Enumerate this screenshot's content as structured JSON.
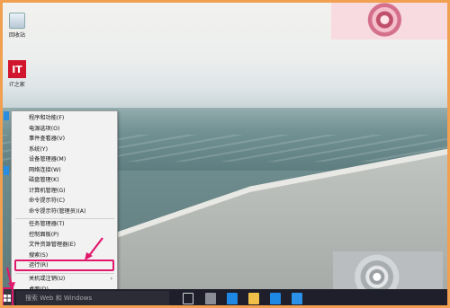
{
  "desktop": {
    "icons": [
      {
        "name": "recycle-bin",
        "label": "回收站"
      },
      {
        "name": "it-shortcut",
        "label": "IT",
        "caption": "IT之家"
      }
    ]
  },
  "context_menu": {
    "group1": [
      "程序和功能(F)",
      "电源选项(O)",
      "事件查看器(V)",
      "系统(Y)",
      "设备管理器(M)",
      "网络连接(W)",
      "磁盘管理(K)",
      "计算机管理(G)",
      "命令提示符(C)",
      "命令提示符(管理员)(A)"
    ],
    "group2": [
      "任务管理器(T)",
      "控制面板(P)",
      "文件资源管理器(E)",
      "搜索(S)",
      "运行(R)"
    ],
    "group3": [
      "关机或注销(U)",
      "桌面(D)"
    ],
    "submenu_arrow": "›"
  },
  "taskbar": {
    "search_placeholder": "搜索 Web 和 Windows"
  },
  "colors": {
    "annotation": "#e0186c",
    "border": "#f0a050",
    "taskbar": "#1e1f2a"
  }
}
